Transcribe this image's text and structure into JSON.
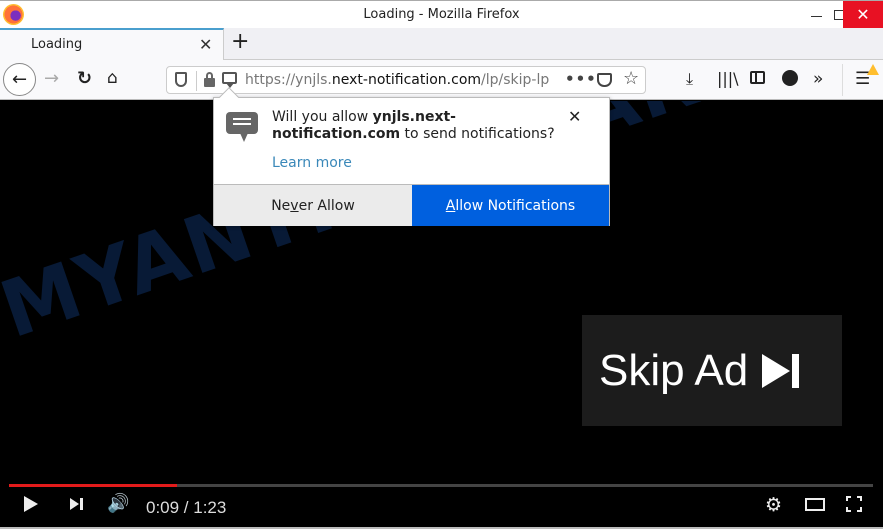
{
  "window": {
    "title": "Loading - Mozilla Firefox",
    "minimize_icon": "minimize-icon",
    "maximize_icon": "maximize-icon",
    "close_glyph": "✕"
  },
  "tabs": [
    {
      "label": "Loading",
      "close_glyph": "✕",
      "active": true
    }
  ],
  "new_tab_glyph": "+",
  "navbar": {
    "back_glyph": "←",
    "forward_glyph": "→",
    "reload_glyph": "↻",
    "home_glyph": "⌂",
    "url": {
      "scheme": "https://ynjls.",
      "host": "next-notification.com",
      "path": "/lp/skip-lp"
    },
    "page_actions_glyph": "•••",
    "bookmark_glyph": "☆",
    "toolbar": {
      "download_glyph": "⤓",
      "library_glyph": "|||\\",
      "overflow_glyph": "»",
      "menu_glyph": "☰"
    }
  },
  "notification_popup": {
    "message_prefix": "Will you allow ",
    "site": "ynjls.next-notification.com",
    "message_suffix": " to send notifications?",
    "close_glyph": "✕",
    "learn_more": "Learn more",
    "never_allow": {
      "before": "Ne",
      "accesskey": "v",
      "after": "er Allow"
    },
    "allow": {
      "before": "",
      "accesskey": "A",
      "after": "llow Notifications"
    },
    "allow_color": "#0060df"
  },
  "page": {
    "watermark": "MYANTISPYWARE.COM",
    "skip_ad_label": "Skip Ad"
  },
  "video_player": {
    "current_time": "0:09",
    "duration": "1:23",
    "time_display": "0:09 / 1:23",
    "progress_fraction": 0.195,
    "progress_color": "#e21b1b",
    "gear_glyph": "⚙",
    "volume_glyph": "🔊"
  }
}
